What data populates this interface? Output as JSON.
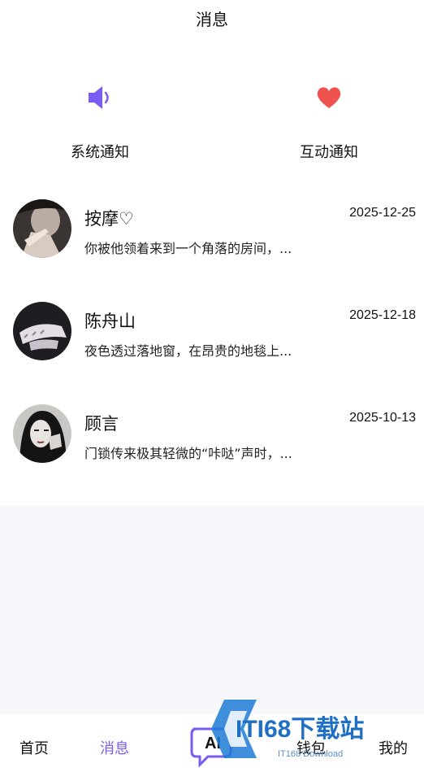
{
  "header": {
    "title": "消息"
  },
  "notifications": {
    "system": {
      "label": "系统通知",
      "icon": "speaker-icon"
    },
    "interaction": {
      "label": "互动通知",
      "icon": "heart-icon"
    }
  },
  "conversations": [
    {
      "name": "按摩♡",
      "date": "2025-12-25",
      "preview": "你被他领着来到一个角落的房间，..."
    },
    {
      "name": "陈舟山",
      "date": "2025-12-18",
      "preview": "夜色透过落地窗，在昂贵的地毯上..."
    },
    {
      "name": "顾言",
      "date": "2025-10-13",
      "preview": "门锁传来极其轻微的“咔哒”声时，..."
    }
  ],
  "tabbar": {
    "home": "首页",
    "messages": "消息",
    "ai": "AI",
    "wallet": "钱包",
    "mine": "我的"
  },
  "watermark": {
    "brand": "ITI68下载站",
    "sub": "IT168 Download"
  },
  "colors": {
    "accent": "#7b5cf0",
    "heart": "#f0524f",
    "speaker": "#7b5cf0"
  }
}
